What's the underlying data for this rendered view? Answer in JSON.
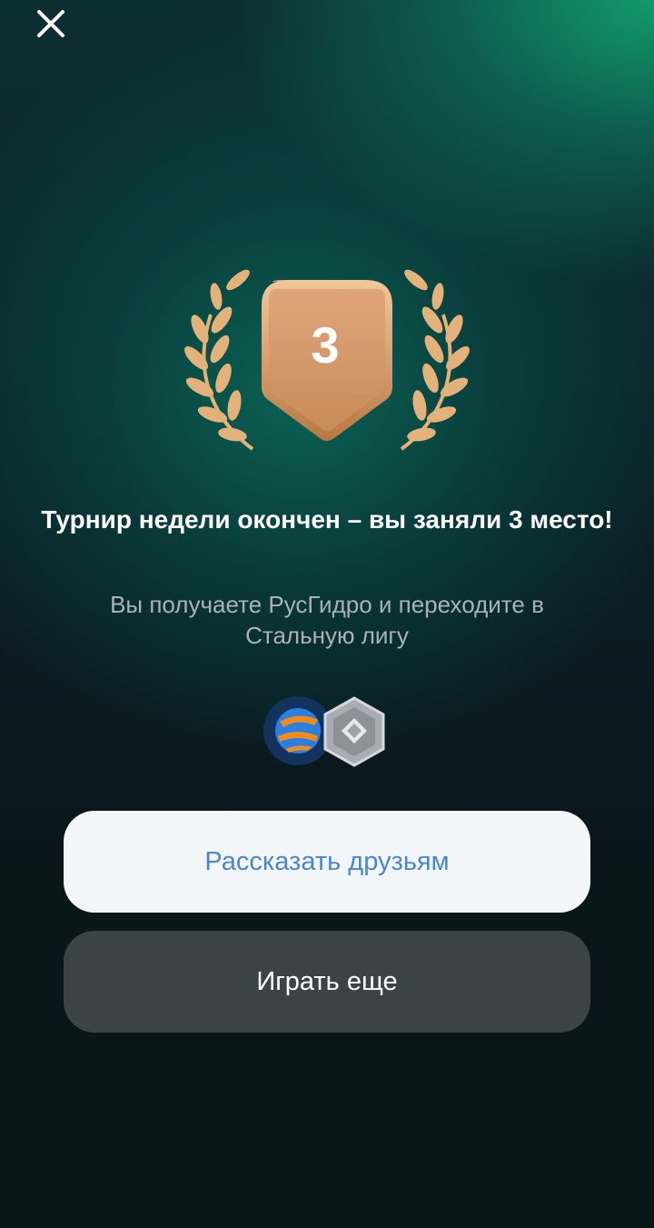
{
  "header": {
    "close_icon": "close-icon"
  },
  "trophy": {
    "place": "3",
    "icon": "laurel-shield-icon",
    "colors": {
      "shield": "#d49a66",
      "laurel": "#e2b27a"
    }
  },
  "result": {
    "title": "Турнир недели окончен – вы заняли 3 место!",
    "subtitle": "Вы получаете РусГидро и переходите в Стальную лигу"
  },
  "rewards": {
    "company_icon": "rushydro-logo-icon",
    "league_icon": "steel-league-badge-icon"
  },
  "actions": {
    "share_label": "Рассказать друзьям",
    "play_label": "Играть еще"
  },
  "colors": {
    "background": "#0b161b",
    "accent_green": "#12a06e",
    "share_button_bg": "#f3f6f8",
    "share_button_text": "#4a86c8",
    "play_button_bg": "#3c4347"
  }
}
